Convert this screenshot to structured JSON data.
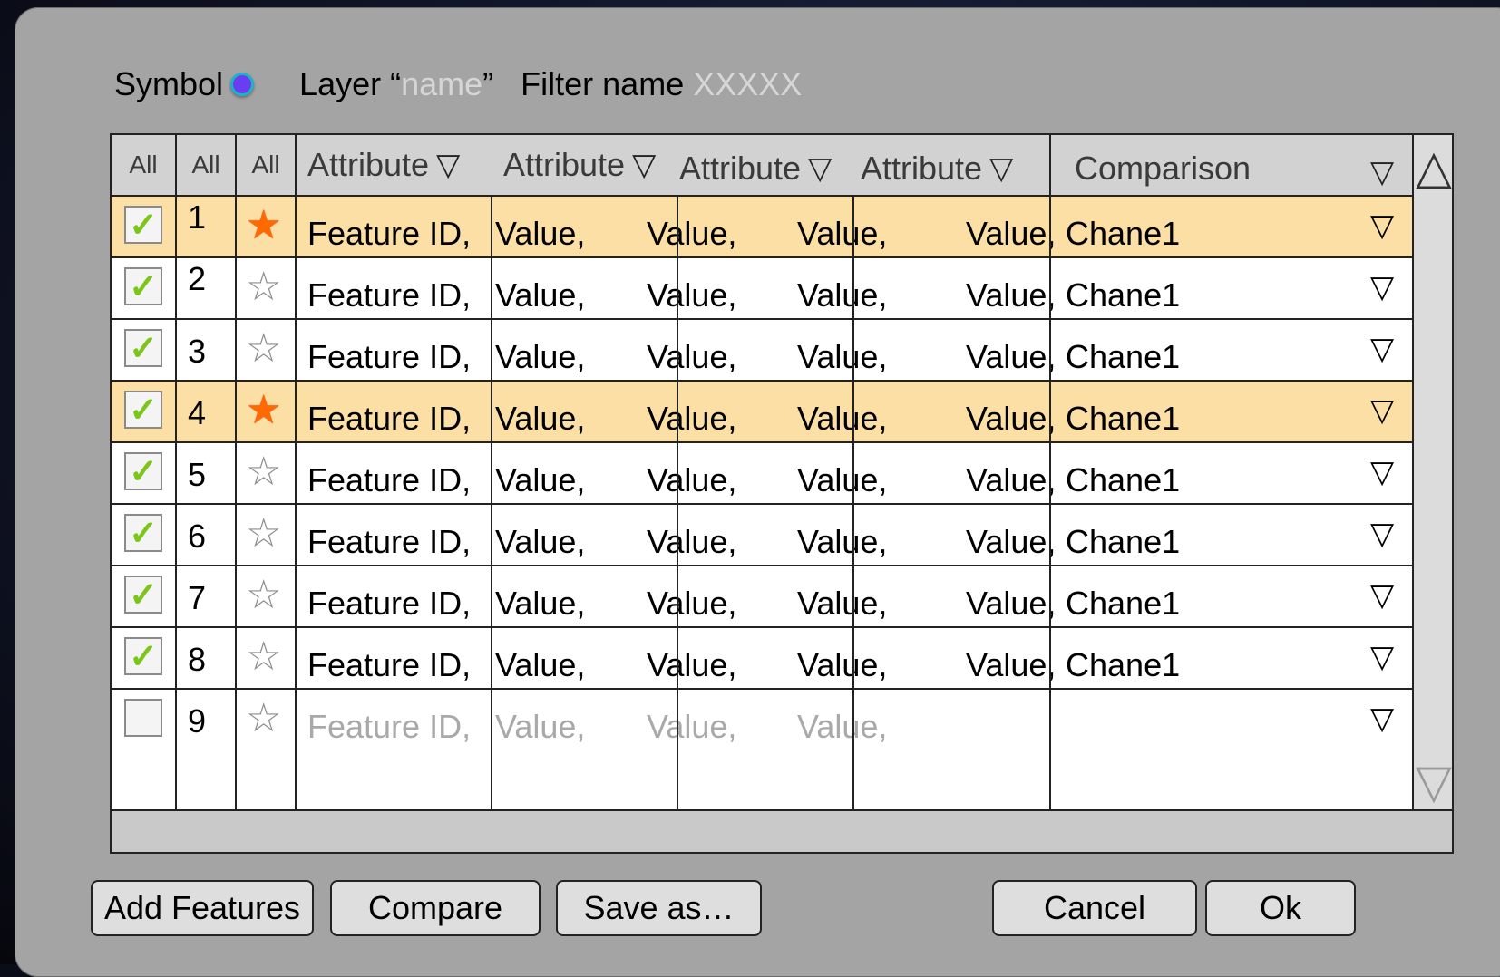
{
  "toolbar": {
    "symbol_label": "Symbol",
    "layer_label": "Layer “",
    "layer_value": "name",
    "layer_close": "”",
    "filter_label": "Filter name",
    "filter_value": "XXXXX"
  },
  "table": {
    "headers": [
      "All",
      "All",
      "All",
      "Attribute",
      "Attribute",
      "Attribute",
      "Attribute",
      "Comparison"
    ],
    "rows": [
      {
        "num": "1",
        "checked": true,
        "starred": true,
        "highlight": true,
        "cells": [
          "Feature ID,",
          "Value,",
          "Value,",
          "Value,",
          "Value,",
          "Chane1"
        ]
      },
      {
        "num": "2",
        "checked": true,
        "starred": false,
        "highlight": false,
        "cells": [
          "Feature ID,",
          "Value,",
          "Value,",
          "Value,",
          "Value,",
          "Chane1"
        ]
      },
      {
        "num": "3",
        "checked": true,
        "starred": false,
        "highlight": false,
        "cells": [
          "Feature ID,",
          "Value,",
          "Value,",
          "Value,",
          "Value,",
          "Chane1"
        ]
      },
      {
        "num": "4",
        "checked": true,
        "starred": true,
        "highlight": true,
        "cells": [
          "Feature ID,",
          "Value,",
          "Value,",
          "Value,",
          "Value,",
          "Chane1"
        ]
      },
      {
        "num": "5",
        "checked": true,
        "starred": false,
        "highlight": false,
        "cells": [
          "Feature ID,",
          "Value,",
          "Value,",
          "Value,",
          "Value,",
          "Chane1"
        ]
      },
      {
        "num": "6",
        "checked": true,
        "starred": false,
        "highlight": false,
        "cells": [
          "Feature ID,",
          "Value,",
          "Value,",
          "Value,",
          "Value,",
          "Chane1"
        ]
      },
      {
        "num": "7",
        "checked": true,
        "starred": false,
        "highlight": false,
        "cells": [
          "Feature ID,",
          "Value,",
          "Value,",
          "Value,",
          "Value,",
          "Chane1"
        ]
      },
      {
        "num": "8",
        "checked": true,
        "starred": false,
        "highlight": false,
        "cells": [
          "Feature ID,",
          "Value,",
          "Value,",
          "Value,",
          "Value,",
          "Chane1"
        ]
      },
      {
        "num": "9",
        "checked": false,
        "starred": false,
        "highlight": false,
        "dim": true,
        "cells": [
          "Feature ID,",
          "Value,",
          "Value,",
          "Value,",
          "",
          ""
        ]
      }
    ]
  },
  "buttons": {
    "add_features": "Add Features",
    "compare": "Compare",
    "save_as": "Save as…",
    "cancel": "Cancel",
    "ok": "Ok"
  },
  "colors": {
    "highlight_row": "#fcdfa4",
    "star_active": "#ff6a00",
    "check": "#7cc51a",
    "dialog_bg": "#a4a4a4"
  },
  "icons": {
    "check": "check-icon",
    "star": "star-icon",
    "sort": "down-triangle-icon",
    "scroll_up": "up-arrow-icon",
    "scroll_down": "down-arrow-icon",
    "symbol": "symbol-dot-icon"
  }
}
